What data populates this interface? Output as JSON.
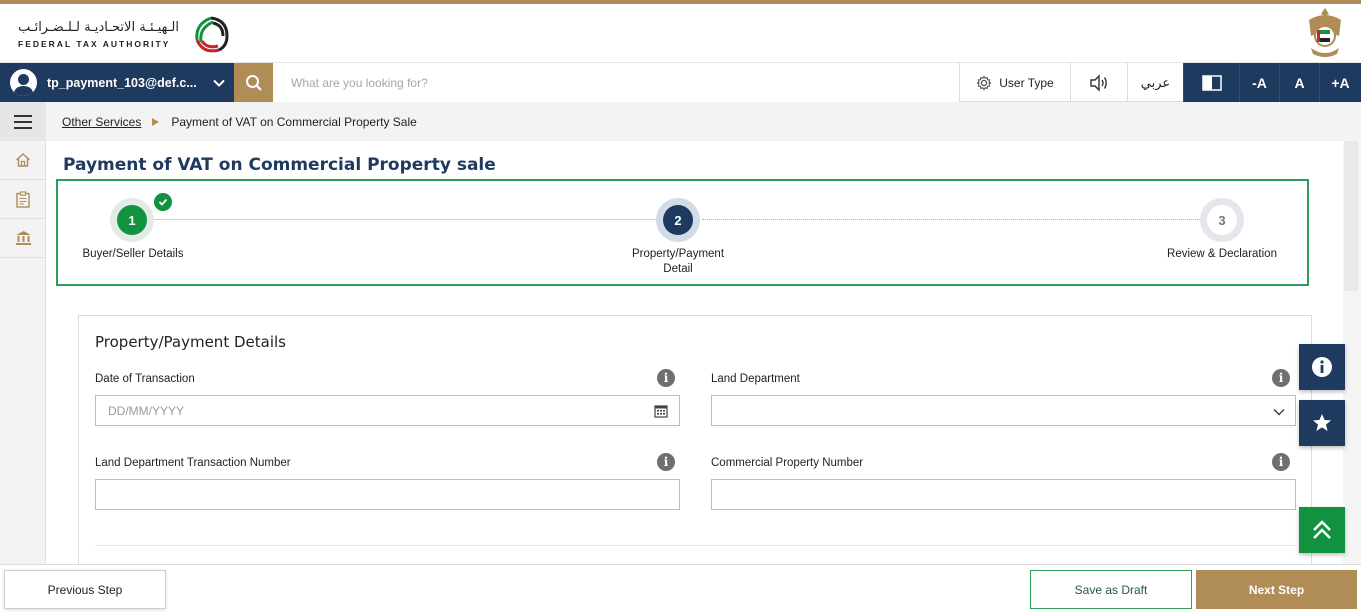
{
  "header": {
    "logo_ar": "الـهيـئـة الاتحـاديـة لـلـضـرائـب",
    "logo_en": "FEDERAL TAX AUTHORITY",
    "brand_gold": "#b08d57",
    "brand_navy": "#1f3a5f",
    "brand_green": "#11923f"
  },
  "toolbar": {
    "user_name": "tp_payment_103@def.c...",
    "search_placeholder": "What are you looking for?",
    "user_type_label": "User Type",
    "language_label": "عربي",
    "font_decrease_label": "-A",
    "font_normal_label": "A",
    "font_increase_label": "+A",
    "icons": [
      "user-avatar-icon",
      "chevron-down-icon",
      "search-icon",
      "gear-icon",
      "speaker-icon",
      "contrast-icon"
    ]
  },
  "sidenav": {
    "icons": [
      "menu-icon",
      "home-icon",
      "clipboard-icon",
      "bank-icon"
    ]
  },
  "breadcrumb": {
    "parent": "Other Services",
    "current": "Payment of VAT on Commercial Property Sale"
  },
  "page": {
    "title": "Payment of VAT on Commercial Property sale"
  },
  "stepper": {
    "steps": [
      {
        "number": "1",
        "label": "Buyer/Seller Details",
        "status": "completed"
      },
      {
        "number": "2",
        "label": "Property/Payment Detail",
        "status": "current"
      },
      {
        "number": "3",
        "label": "Review & Declaration",
        "status": "pending"
      }
    ]
  },
  "form": {
    "section_title": "Property/Payment Details",
    "fields": {
      "date_of_transaction": {
        "label": "Date of Transaction",
        "placeholder": "DD/MM/YYYY",
        "value": ""
      },
      "land_department": {
        "label": "Land Department",
        "value": ""
      },
      "land_dept_txn_number": {
        "label": "Land Department Transaction Number",
        "value": ""
      },
      "commercial_property_number": {
        "label": "Commercial Property Number",
        "value": ""
      }
    }
  },
  "footer": {
    "previous_label": "Previous Step",
    "draft_label": "Save as Draft",
    "next_label": "Next Step"
  }
}
